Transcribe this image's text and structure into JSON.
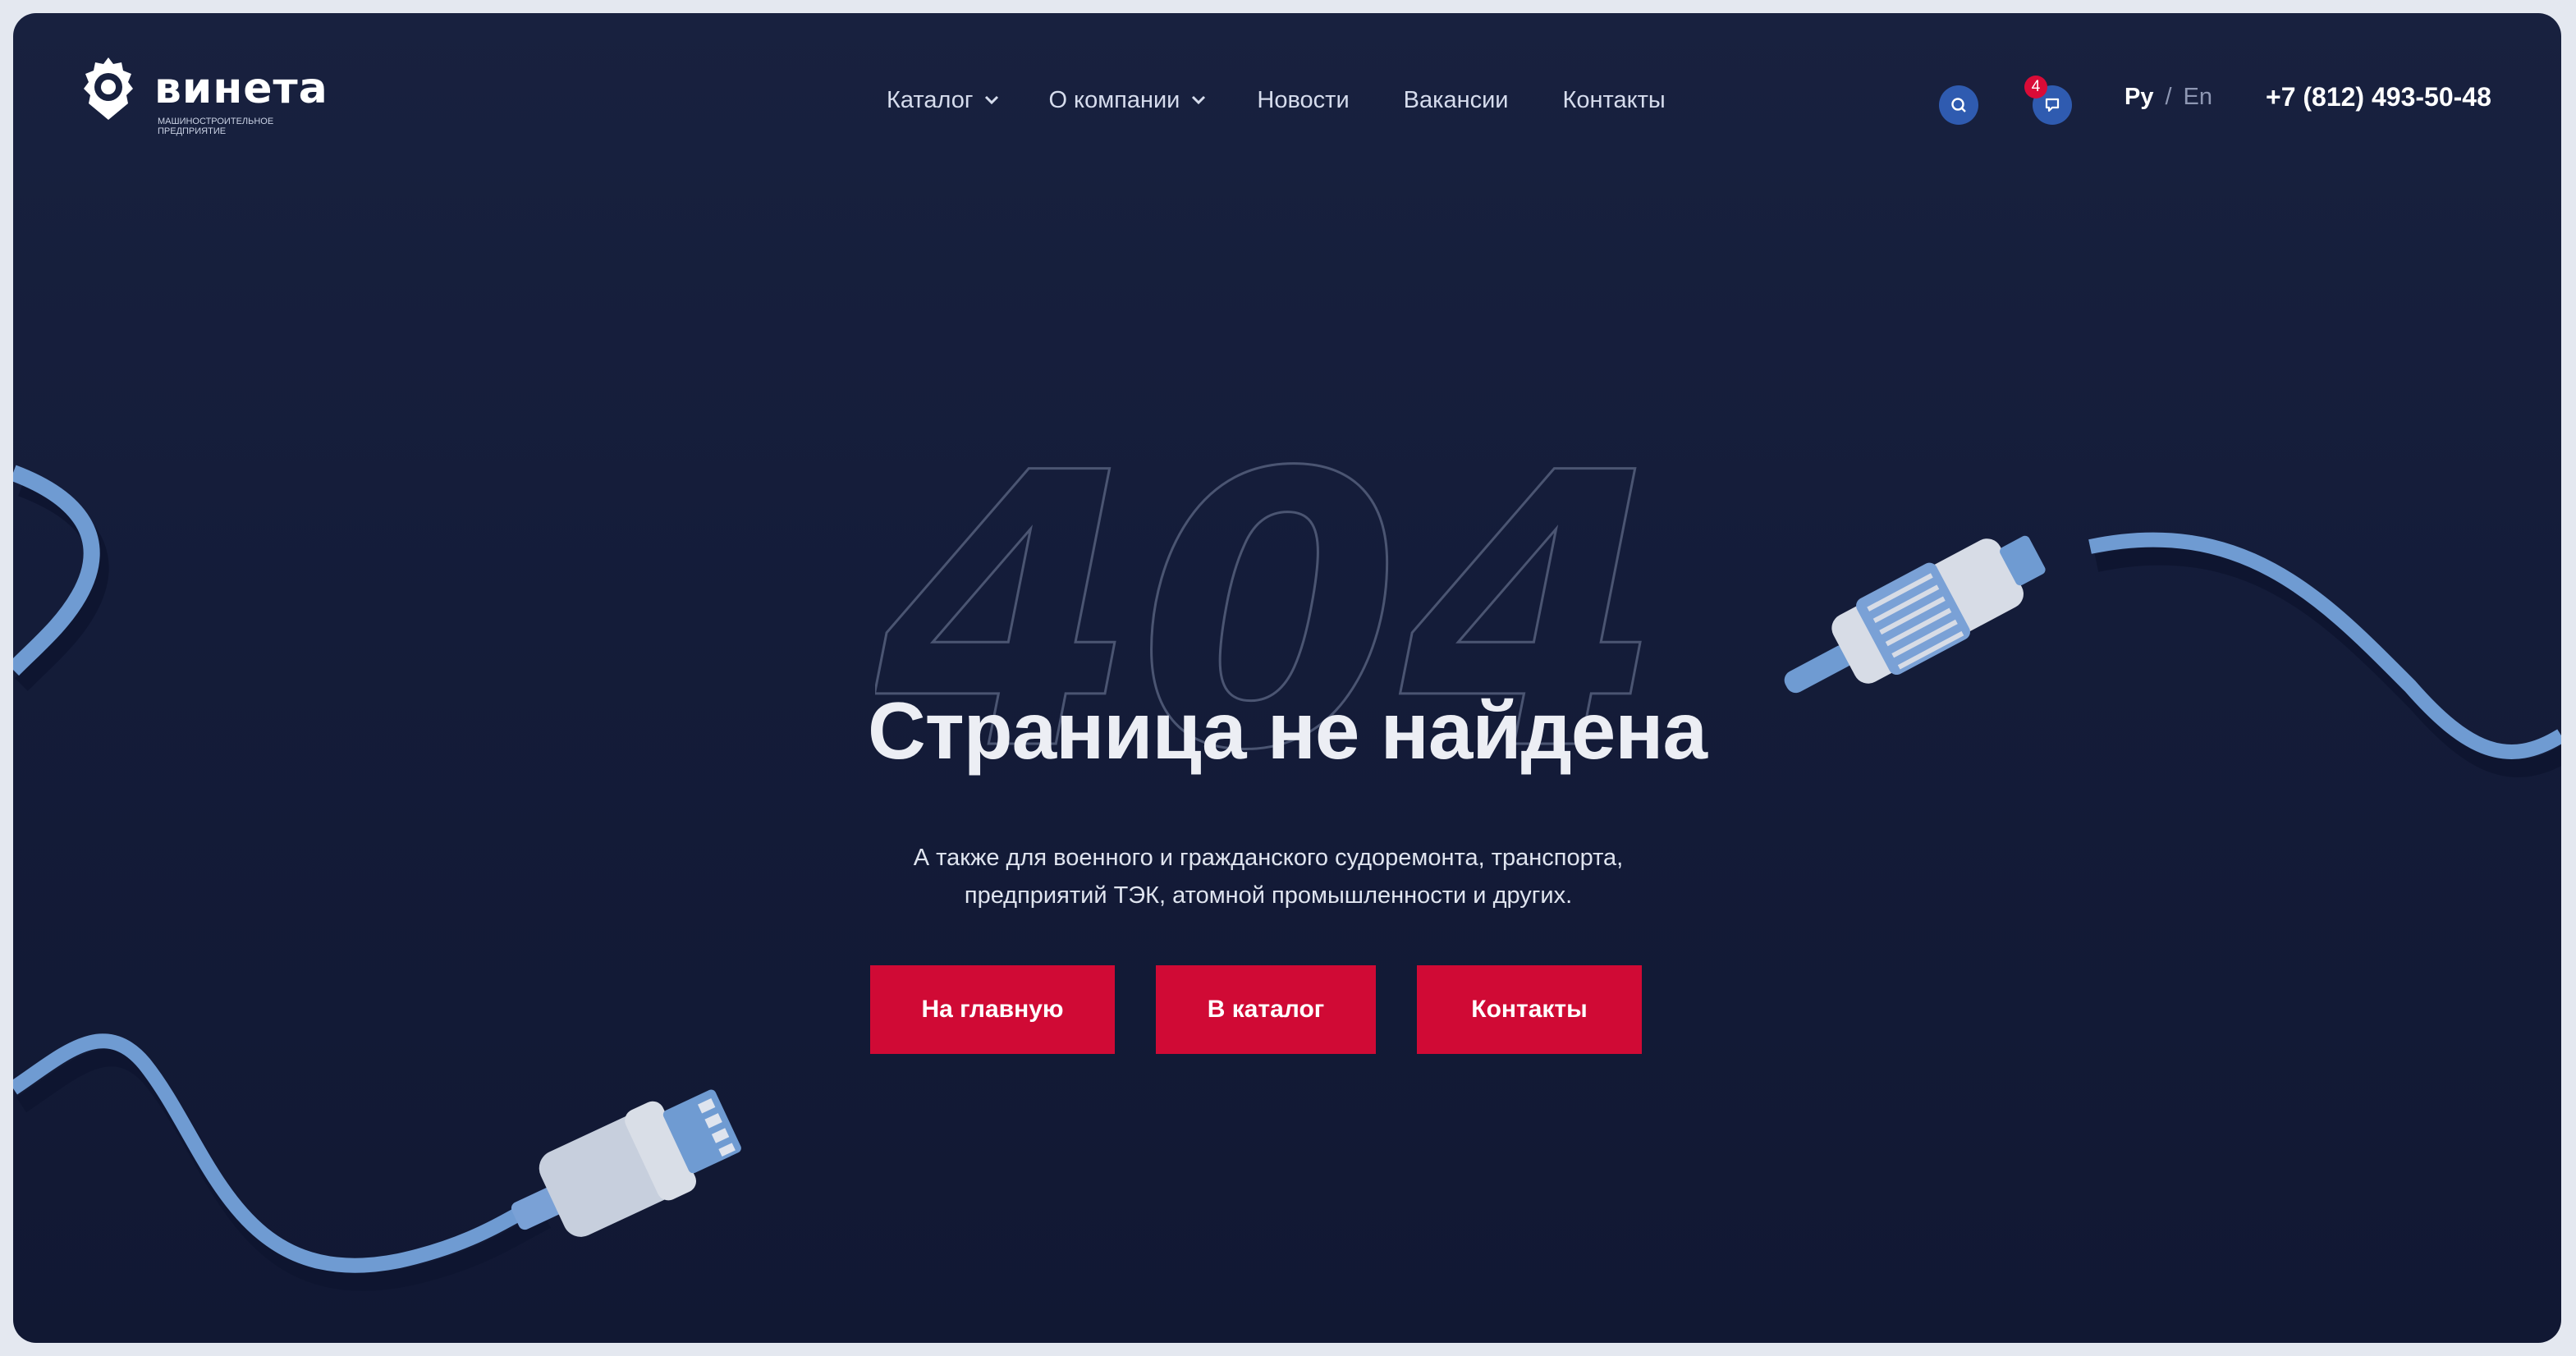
{
  "brand": {
    "name": "винета",
    "tagline": "машиностроительное предприятие"
  },
  "nav": {
    "items": [
      {
        "label": "Каталог",
        "dropdown": true
      },
      {
        "label": "О компании",
        "dropdown": true
      },
      {
        "label": "Новости",
        "dropdown": false
      },
      {
        "label": "Вакансии",
        "dropdown": false
      },
      {
        "label": "Контакты",
        "dropdown": false
      }
    ]
  },
  "header": {
    "search_icon": "search-icon",
    "chat_icon": "chat-icon",
    "chat_badge_count": "4",
    "lang_ru": "Ру",
    "lang_sep": "/",
    "lang_en": "En",
    "phone": "+7 (812) 493-50-48"
  },
  "hero": {
    "error_code": "404",
    "title": "Страница не найдена",
    "subtitle_line1": "А также для военного и гражданского судоремонта, транспорта,",
    "subtitle_line2": "предприятий ТЭК, атомной промышленности и других.",
    "buttons": {
      "home": "На главную",
      "catalog": "В каталог",
      "contacts": "Контакты"
    }
  },
  "colors": {
    "background": "#141c39",
    "accent_red": "#d00a35",
    "accent_blue": "#2f5bb0",
    "cable_blue": "#6f9bd2"
  }
}
